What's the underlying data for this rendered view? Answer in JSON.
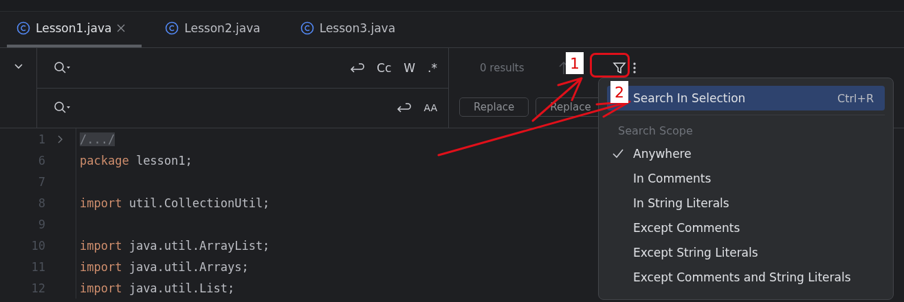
{
  "tabs": [
    {
      "label": "Lesson1.java",
      "selected": true
    },
    {
      "label": "Lesson2.java",
      "selected": false
    },
    {
      "label": "Lesson3.java",
      "selected": false
    }
  ],
  "find_bar": {
    "options": [
      "Cc",
      "W",
      ".*"
    ],
    "replace_options": [
      "AA"
    ],
    "results": "0 results",
    "replace_buttons": [
      "Replace",
      "Replace"
    ]
  },
  "code_lines": [
    {
      "number": "1",
      "folded": true,
      "tokens": [
        {
          "kind": "fold",
          "text": "/.../"
        }
      ]
    },
    {
      "number": "6",
      "folded": false,
      "tokens": [
        {
          "kind": "keyword",
          "text": "package"
        },
        {
          "kind": "plain",
          "text": " lesson1;"
        }
      ]
    },
    {
      "number": "7",
      "folded": false
    },
    {
      "number": "8",
      "folded": false,
      "tokens": [
        {
          "kind": "keyword",
          "text": "import"
        },
        {
          "kind": "plain",
          "text": " util.CollectionUtil;"
        }
      ]
    },
    {
      "number": "9",
      "folded": false
    },
    {
      "number": "10",
      "folded": false,
      "tokens": [
        {
          "kind": "keyword",
          "text": "import"
        },
        {
          "kind": "plain",
          "text": " java.util.ArrayList;"
        }
      ]
    },
    {
      "number": "11",
      "folded": false,
      "tokens": [
        {
          "kind": "keyword",
          "text": "import"
        },
        {
          "kind": "plain",
          "text": " java.util.Arrays;"
        }
      ]
    },
    {
      "number": "12",
      "folded": false,
      "tokens": [
        {
          "kind": "keyword",
          "text": "import"
        },
        {
          "kind": "plain",
          "text": " java.util.List;"
        }
      ]
    }
  ],
  "menu": {
    "items": [
      {
        "kind": "action",
        "label": "Search In Selection",
        "shortcut": "Ctrl+R",
        "selected": true
      },
      {
        "kind": "header",
        "label": "Search Scope"
      },
      {
        "kind": "option",
        "label": "Anywhere",
        "checked": true
      },
      {
        "kind": "option",
        "label": "In Comments",
        "checked": false
      },
      {
        "kind": "option",
        "label": "In String Literals",
        "checked": false
      },
      {
        "kind": "option",
        "label": "Except Comments",
        "checked": false
      },
      {
        "kind": "option",
        "label": "Except String Literals",
        "checked": false
      },
      {
        "kind": "option",
        "label": "Except Comments and String Literals",
        "checked": false
      }
    ]
  },
  "annotations": [
    {
      "label": "1"
    },
    {
      "label": "2"
    }
  ]
}
